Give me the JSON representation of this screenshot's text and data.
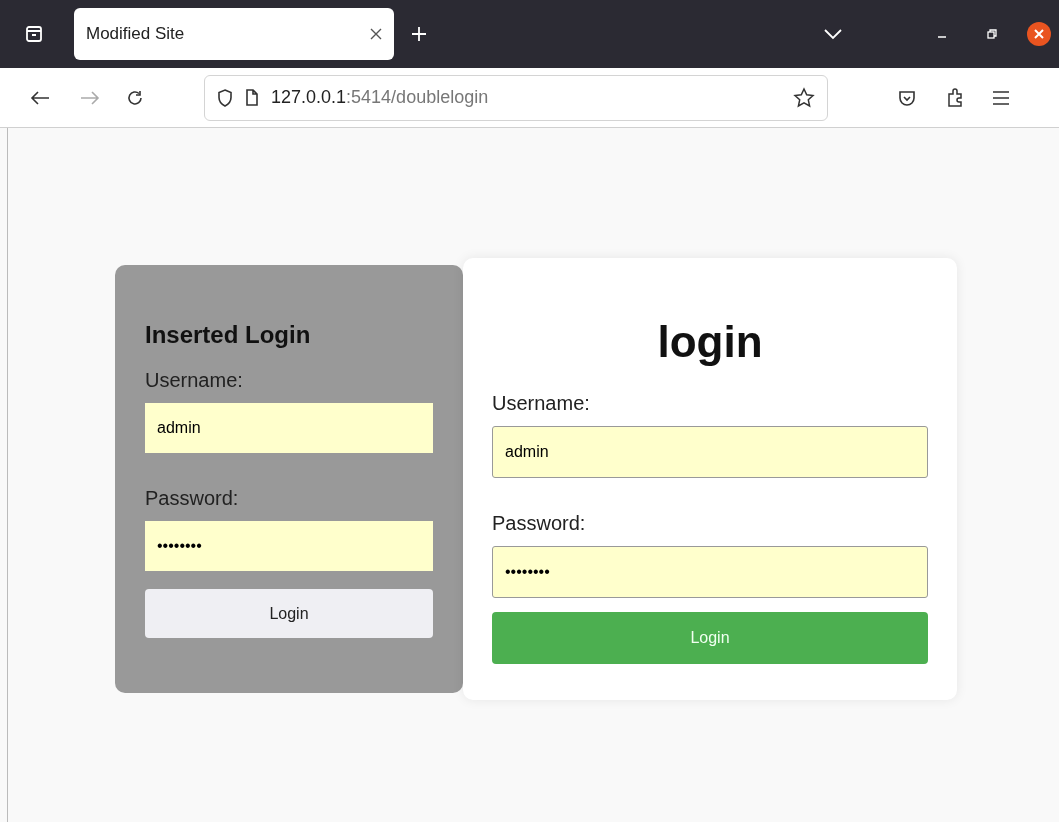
{
  "browser": {
    "tabs": [
      {
        "title": "Modified Site",
        "selected": true
      }
    ],
    "url": {
      "host": "127.0.0.1",
      "rest": ":5414/doublelogin"
    }
  },
  "inserted_login": {
    "title": "Inserted Login",
    "username_label": "Username:",
    "username": "admin",
    "password_label": "Password:",
    "password": "••••••••",
    "button": "Login"
  },
  "login": {
    "title": "login",
    "username_label": "Username:",
    "username": "admin",
    "password_label": "Password:",
    "password": "••••••••",
    "button": "Login"
  }
}
